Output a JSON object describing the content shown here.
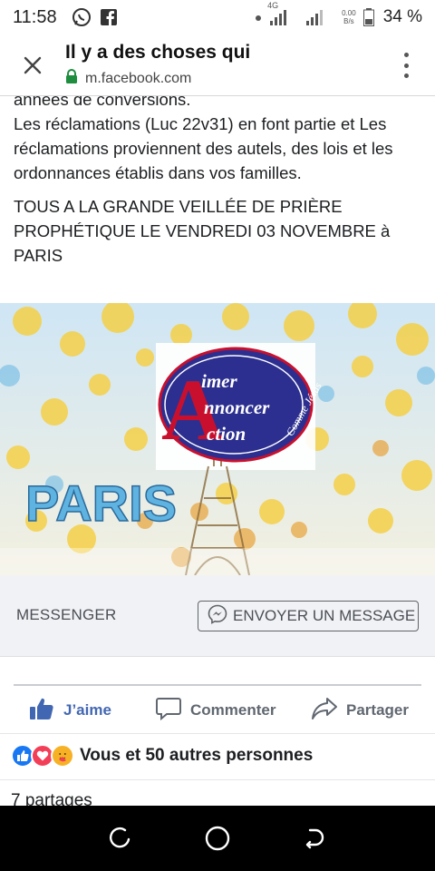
{
  "status_bar": {
    "time": "11:58",
    "network_type": "4G",
    "data_speed_value": "0.00",
    "data_speed_unit": "B/s",
    "battery": "34 %",
    "icons": [
      "whatsapp-icon",
      "facebook-icon",
      "dot-icon",
      "signal-icon",
      "signal-icon",
      "battery-icon"
    ]
  },
  "browser": {
    "title": "Il y a des choses qui",
    "url": "m.facebook.com",
    "icons": [
      "close-icon",
      "lock-icon",
      "more-vert-icon"
    ]
  },
  "post": {
    "cut_line": "années de conversions.",
    "paragraph1": "Les réclamations (Luc 22v31) en font partie et Les réclamations proviennent des autels, des lois et les ordonnances établis dans vos familles.",
    "paragraph2": "TOUS A LA GRANDE VEILLÉE DE PRIÈRE PROPHÉTIQUE LE VENDREDI 03 NOVEMBRE à PARIS"
  },
  "banner": {
    "logo_big_letter": "A",
    "logo_line1": "imer",
    "logo_line2": "nnoncer",
    "logo_line3": "ction",
    "logo_curve": "Comme Jésus",
    "city": "PARIS",
    "colors": {
      "logo_fill": "#2c2f8f",
      "logo_letter": "#c8102e",
      "city_text": "#5fb3e0"
    }
  },
  "messenger": {
    "label": "MESSENGER",
    "button_label": "ENVOYER UN MESSAGE",
    "button_icon": "messenger-icon"
  },
  "actions": {
    "like": "J’aime",
    "comment": "Commenter",
    "share": "Partager",
    "icons": [
      "thumbs-up-icon",
      "comment-icon",
      "share-icon"
    ]
  },
  "reactions": {
    "text": "Vous et 50 autres personnes",
    "icons": [
      "like-reaction-icon",
      "love-reaction-icon",
      "care-reaction-icon"
    ]
  },
  "shares": {
    "text": "7 partages"
  },
  "nav": {
    "icons": [
      "recents-icon",
      "home-icon",
      "back-icon"
    ]
  },
  "colors": {
    "facebook_blue": "#4267b2",
    "lock_green": "#1e8e3e",
    "text_gray": "#606770"
  }
}
